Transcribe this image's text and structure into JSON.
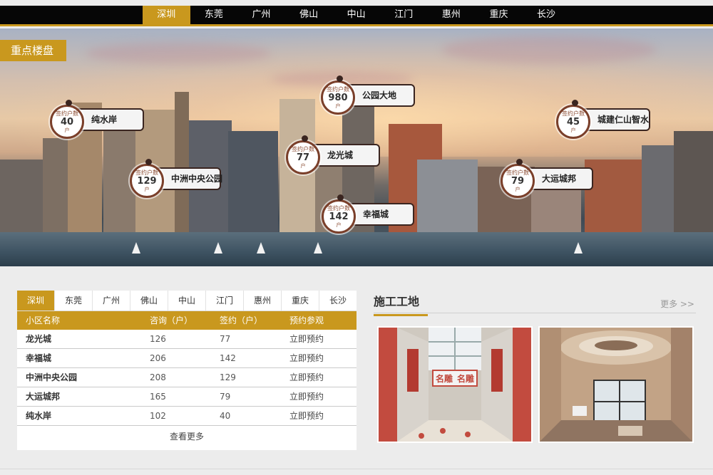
{
  "top_nav": {
    "items": [
      "深圳",
      "东莞",
      "广州",
      "佛山",
      "中山",
      "江门",
      "惠州",
      "重庆",
      "长沙"
    ],
    "active_index": 0
  },
  "banner": {
    "section_title": "重点楼盘",
    "markers": [
      {
        "name": "纯水岸",
        "label_top": "签约户数",
        "count": "40",
        "unit": "户"
      },
      {
        "name": "公园大地",
        "label_top": "签约户数",
        "count": "980",
        "unit": "户"
      },
      {
        "name": "城建仁山智水",
        "label_top": "签约户数",
        "count": "45",
        "unit": "户"
      },
      {
        "name": "龙光城",
        "label_top": "签约户数",
        "count": "77",
        "unit": "户"
      },
      {
        "name": "中洲中央公园",
        "label_top": "签约户数",
        "count": "129",
        "unit": "户"
      },
      {
        "name": "大运城邦",
        "label_top": "签约户数",
        "count": "79",
        "unit": "户"
      },
      {
        "name": "幸福城",
        "label_top": "签约户数",
        "count": "142",
        "unit": "户"
      }
    ]
  },
  "table_panel": {
    "tabs": [
      "深圳",
      "东莞",
      "广州",
      "佛山",
      "中山",
      "江门",
      "惠州",
      "重庆",
      "长沙"
    ],
    "active_tab": 0,
    "headers": [
      "小区名称",
      "咨询（户）",
      "签约（户）",
      "预约参观"
    ],
    "rows": [
      {
        "name": "龙光城",
        "inquiry": "126",
        "signed": "77",
        "action": "立即预约"
      },
      {
        "name": "幸福城",
        "inquiry": "206",
        "signed": "142",
        "action": "立即预约"
      },
      {
        "name": "中洲中央公园",
        "inquiry": "208",
        "signed": "129",
        "action": "立即预约"
      },
      {
        "name": "大运城邦",
        "inquiry": "165",
        "signed": "79",
        "action": "立即预约"
      },
      {
        "name": "纯水岸",
        "inquiry": "102",
        "signed": "40",
        "action": "立即预约"
      }
    ],
    "more_label": "查看更多"
  },
  "construction": {
    "title": "施工工地",
    "more_label": "更多 >>"
  },
  "colors": {
    "accent": "#c9981e",
    "nav_bg": "#060606",
    "marker_ring": "#7a3f2a"
  }
}
